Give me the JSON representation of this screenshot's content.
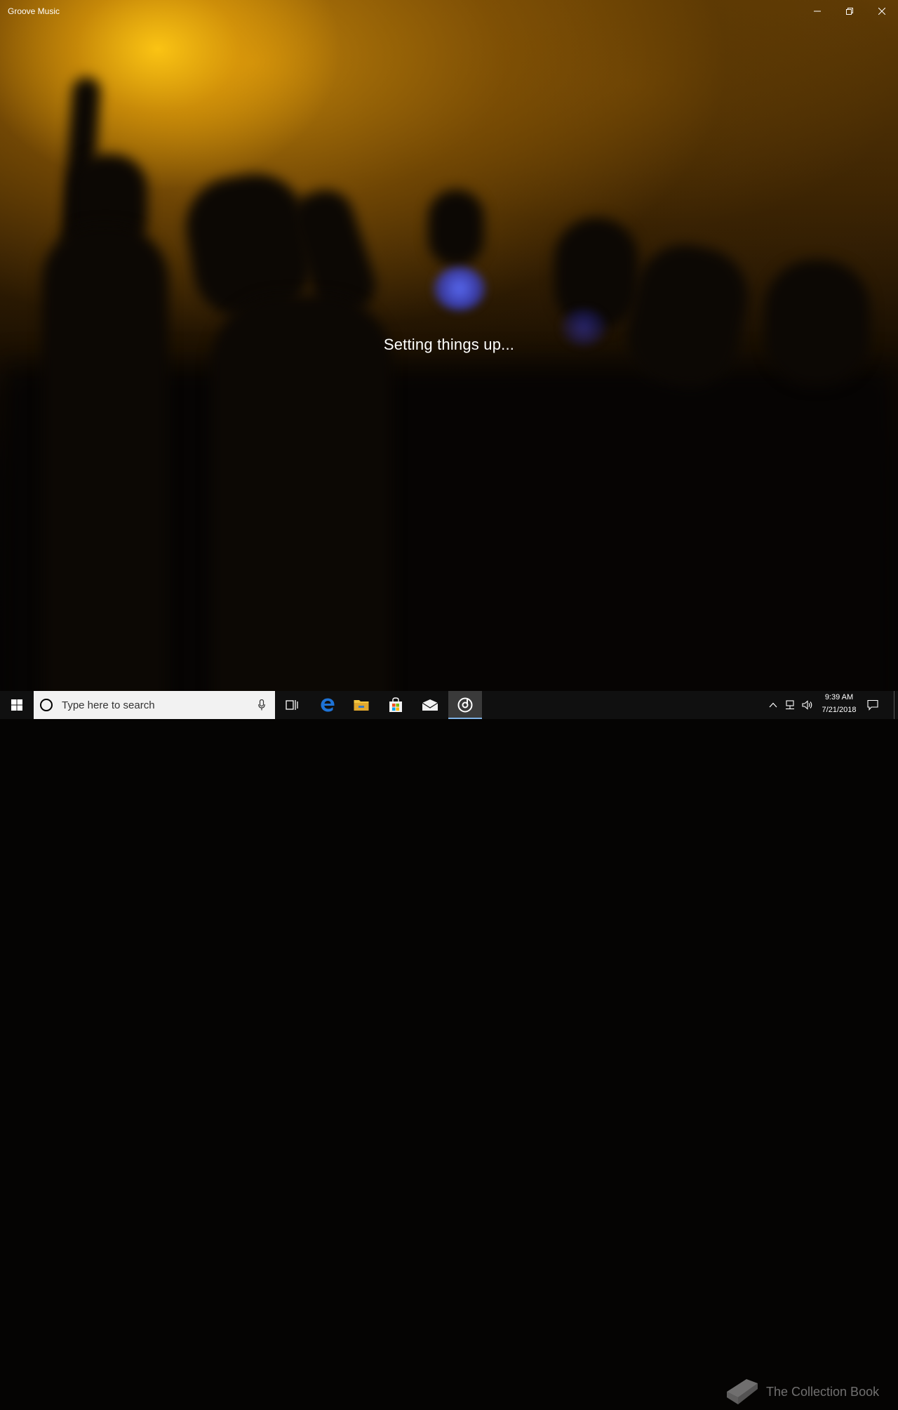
{
  "window": {
    "title": "Groove Music",
    "controls": [
      "minimize",
      "restore",
      "close"
    ]
  },
  "main": {
    "status": "Setting things up..."
  },
  "taskbar": {
    "search": {
      "placeholder": "Type here to search"
    },
    "pinned": [
      {
        "name": "task-view-icon"
      },
      {
        "name": "edge-icon"
      },
      {
        "name": "file-explorer-icon"
      },
      {
        "name": "store-icon"
      },
      {
        "name": "mail-icon"
      },
      {
        "name": "groove-music-icon",
        "active": true
      }
    ],
    "clock": {
      "time": "9:39 AM",
      "date": "7/21/2018"
    }
  },
  "watermark": {
    "text": "The Collection Book"
  },
  "colors": {
    "taskbar_bg": "#101010",
    "search_bg": "#f2f2f2",
    "active_indicator": "#7fb2e5",
    "edge_blue": "#1e73d6",
    "folder_yellow": "#f2c641"
  }
}
